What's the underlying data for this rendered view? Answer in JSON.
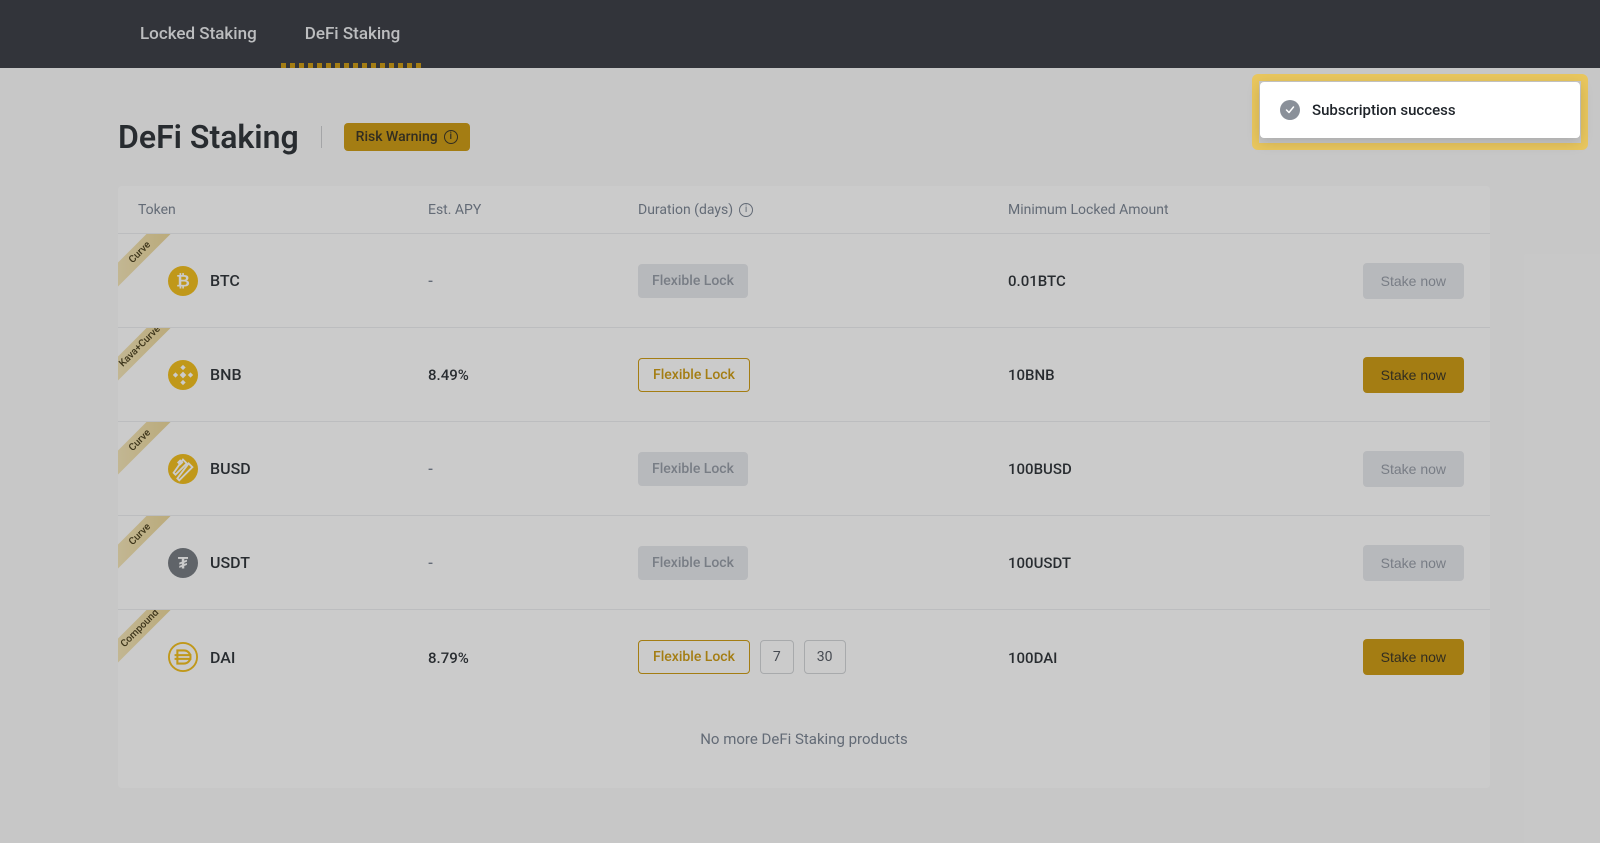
{
  "tabs": {
    "locked": "Locked Staking",
    "defi": "DeFi Staking"
  },
  "page": {
    "title": "DeFi Staking",
    "riskWarning": "Risk Warning"
  },
  "tableHeaders": {
    "token": "Token",
    "apy": "Est. APY",
    "duration": "Duration (days)",
    "min": "Minimum Locked Amount"
  },
  "rows": [
    {
      "ribbon": "Curve",
      "symbol": "BTC",
      "apy": "-",
      "apyDash": true,
      "flexLabel": "Flexible Lock",
      "durationActive": false,
      "extraDurations": [],
      "min": "0.01BTC",
      "stakeLabel": "Stake now",
      "stakeEnabled": false,
      "iconBg": "#f0b90b"
    },
    {
      "ribbon": "Kava+Curve",
      "symbol": "BNB",
      "apy": "8.49%",
      "apyDash": false,
      "flexLabel": "Flexible Lock",
      "durationActive": true,
      "extraDurations": [],
      "min": "10BNB",
      "stakeLabel": "Stake now",
      "stakeEnabled": true,
      "iconBg": "#f0b90b"
    },
    {
      "ribbon": "Curve",
      "symbol": "BUSD",
      "apy": "-",
      "apyDash": true,
      "flexLabel": "Flexible Lock",
      "durationActive": false,
      "extraDurations": [],
      "min": "100BUSD",
      "stakeLabel": "Stake now",
      "stakeEnabled": false,
      "iconBg": "#f0b90b"
    },
    {
      "ribbon": "Curve",
      "symbol": "USDT",
      "apy": "-",
      "apyDash": true,
      "flexLabel": "Flexible Lock",
      "durationActive": false,
      "extraDurations": [],
      "min": "100USDT",
      "stakeLabel": "Stake now",
      "stakeEnabled": false,
      "iconBg": "#6b7178"
    },
    {
      "ribbon": "Compound",
      "symbol": "DAI",
      "apy": "8.79%",
      "apyDash": false,
      "flexLabel": "Flexible Lock",
      "durationActive": true,
      "extraDurations": [
        "7",
        "30"
      ],
      "min": "100DAI",
      "stakeLabel": "Stake now",
      "stakeEnabled": true,
      "iconBg": "#f0b90b"
    }
  ],
  "footer": {
    "noMore": "No more DeFi Staking products"
  },
  "toast": {
    "text": "Subscription success"
  }
}
